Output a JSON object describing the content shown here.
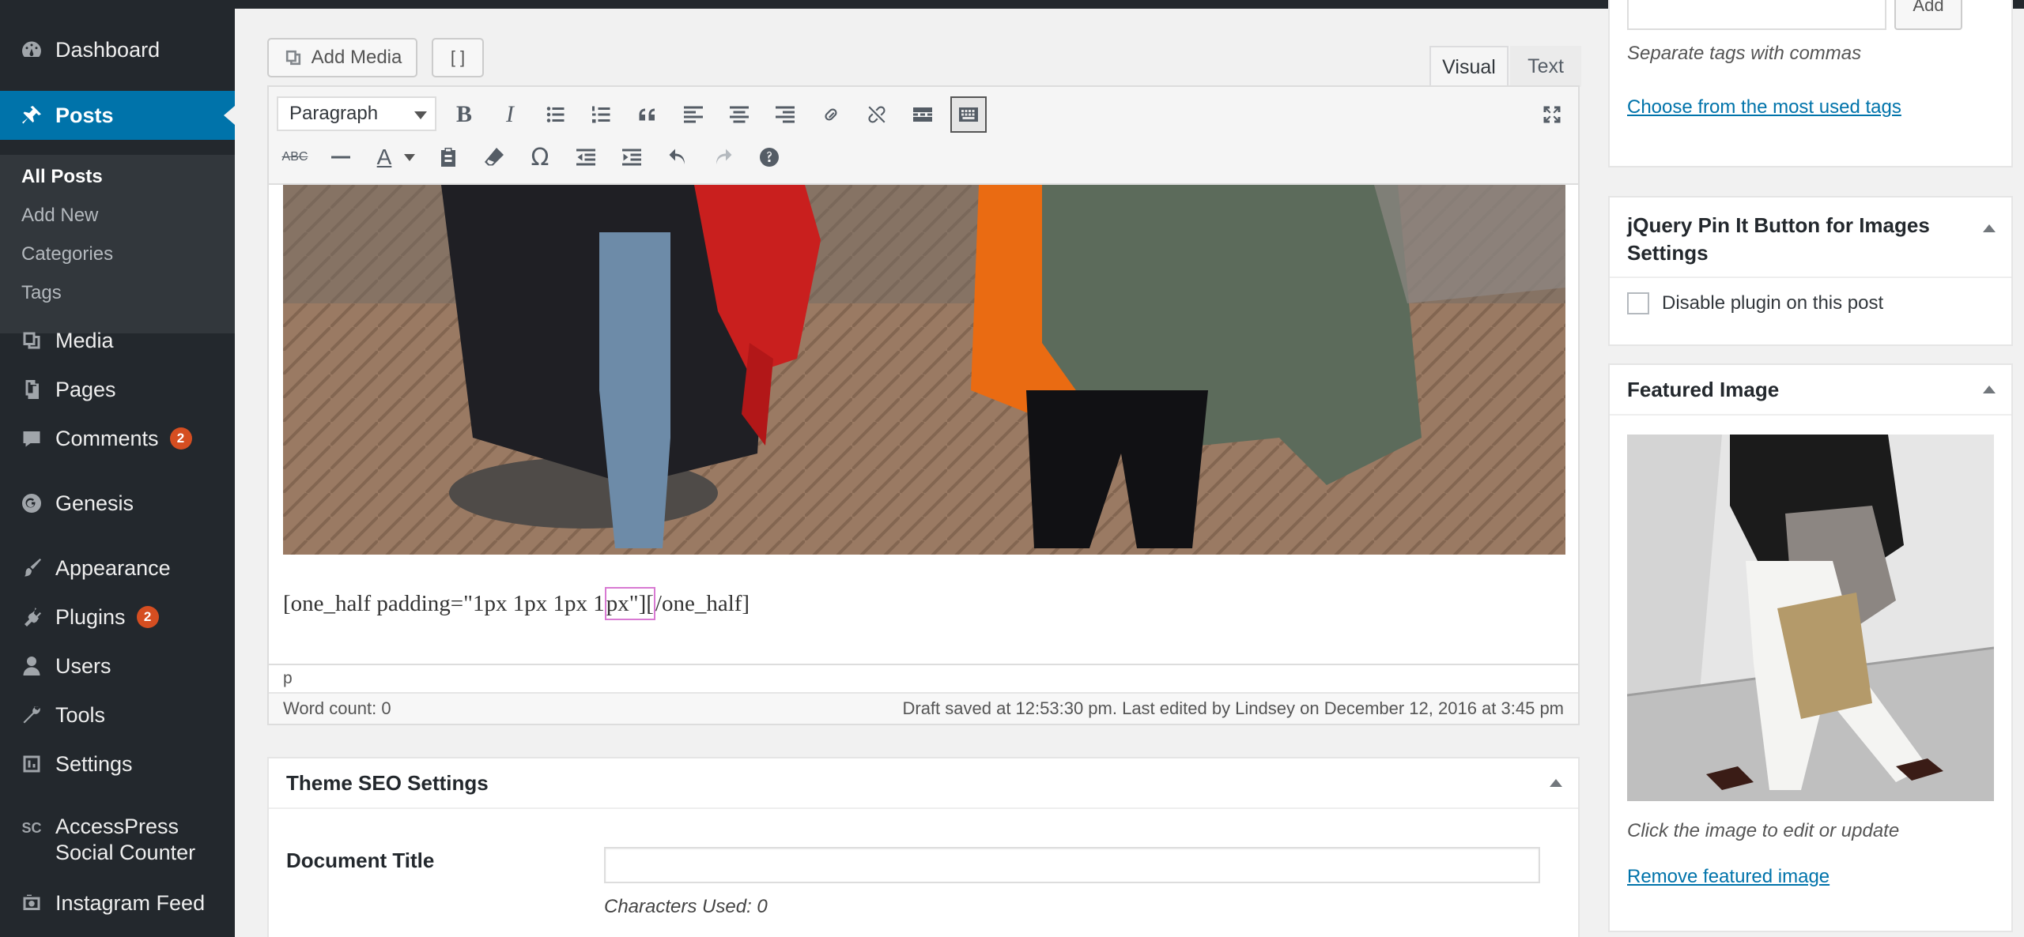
{
  "sidebar": {
    "items": [
      {
        "label": "Dashboard",
        "icon": "dashboard-icon"
      },
      {
        "label": "Posts",
        "icon": "pushpin-icon"
      },
      {
        "label": "Media",
        "icon": "media-icon"
      },
      {
        "label": "Pages",
        "icon": "pages-icon"
      },
      {
        "label": "Comments",
        "icon": "comment-icon",
        "badge": "2"
      },
      {
        "label": "Genesis",
        "icon": "genesis-icon"
      },
      {
        "label": "Appearance",
        "icon": "paintbrush-icon"
      },
      {
        "label": "Plugins",
        "icon": "plugin-icon",
        "badge": "2"
      },
      {
        "label": "Users",
        "icon": "user-icon"
      },
      {
        "label": "Tools",
        "icon": "wrench-icon"
      },
      {
        "label": "Settings",
        "icon": "settings-icon"
      },
      {
        "label": "AccessPress Social Counter",
        "line1": "AccessPress",
        "line2": "Social Counter",
        "icon": "sc-icon",
        "icon_text": "SC"
      },
      {
        "label": "Instagram Feed",
        "icon": "instagram-icon"
      }
    ],
    "submenu": [
      "All Posts",
      "Add New",
      "Categories",
      "Tags"
    ]
  },
  "editor": {
    "add_media_label": "Add Media",
    "tabs": [
      "Visual",
      "Text"
    ],
    "format_select": "Paragraph",
    "shortcode_before": "[one_half padding=\"1px 1px 1px 1",
    "shortcode_selected": "px\"][",
    "shortcode_after": "/one_half]",
    "path": "p",
    "word_count": "Word count: 0",
    "draft_status": "Draft saved at 12:53:30 pm. Last edited by Lindsey on December 12, 2016 at 3:45 pm"
  },
  "seo": {
    "title": "Theme SEO Settings",
    "doc_title_label": "Document Title",
    "doc_title_value": "",
    "chars_used": "Characters Used: 0"
  },
  "tags": {
    "add_label": "Add",
    "hint": "Separate tags with commas",
    "link": "Choose from the most used tags"
  },
  "pin": {
    "title": "jQuery Pin It Button for Images Settings",
    "checkbox_label": "Disable plugin on this post"
  },
  "featured": {
    "title": "Featured Image",
    "hint": "Click the image to edit or update",
    "remove_link": "Remove featured image"
  },
  "colors": {
    "sidebar_bg": "#23282d",
    "accent": "#0073aa",
    "badge": "#d54e21",
    "link": "#0073aa"
  }
}
